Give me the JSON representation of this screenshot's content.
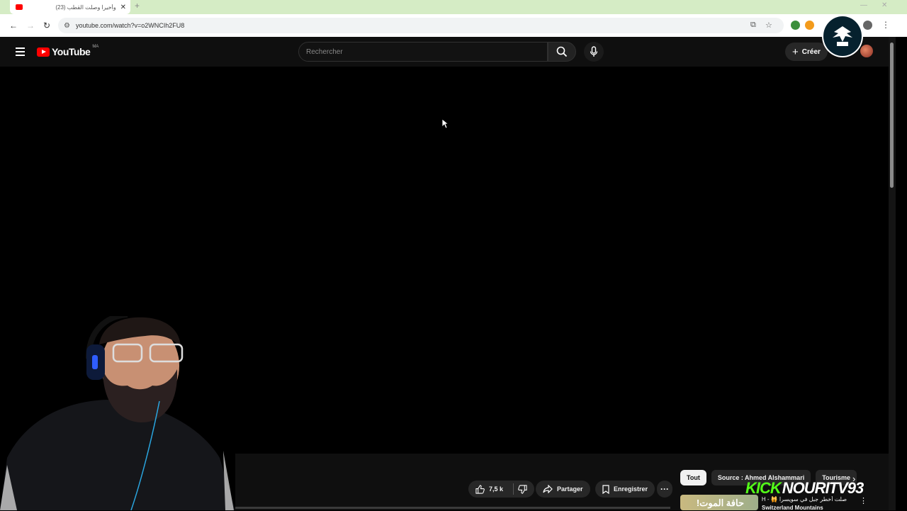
{
  "browser": {
    "tab_title": "وأخيرا وصلت القطب (23)",
    "url": "youtube.com/watch?v=o2WNCIh2FU8"
  },
  "header": {
    "logo_text": "YouTube",
    "country_code": "MA",
    "search_placeholder": "Rechercher",
    "create_label": "Créer"
  },
  "actions": {
    "like_count": "7,5 k",
    "share_label": "Partager",
    "save_label": "Enregistrer"
  },
  "chips": [
    "Tout",
    "Source : Ahmed Alshammari",
    "Tourisme"
  ],
  "recommendation": {
    "thumb_text": "حافة الموت!",
    "title": "صلت أخطر جبل في سويسرا 🙀 - CH",
    "subtitle": "Switzerland Mountains"
  },
  "overlay": {
    "kick_brand": "KICK",
    "channel": "NOURITV93"
  },
  "colors": {
    "yt_red": "#ff0000",
    "kick_green": "#53fc18",
    "bg": "#0f0f0f"
  }
}
